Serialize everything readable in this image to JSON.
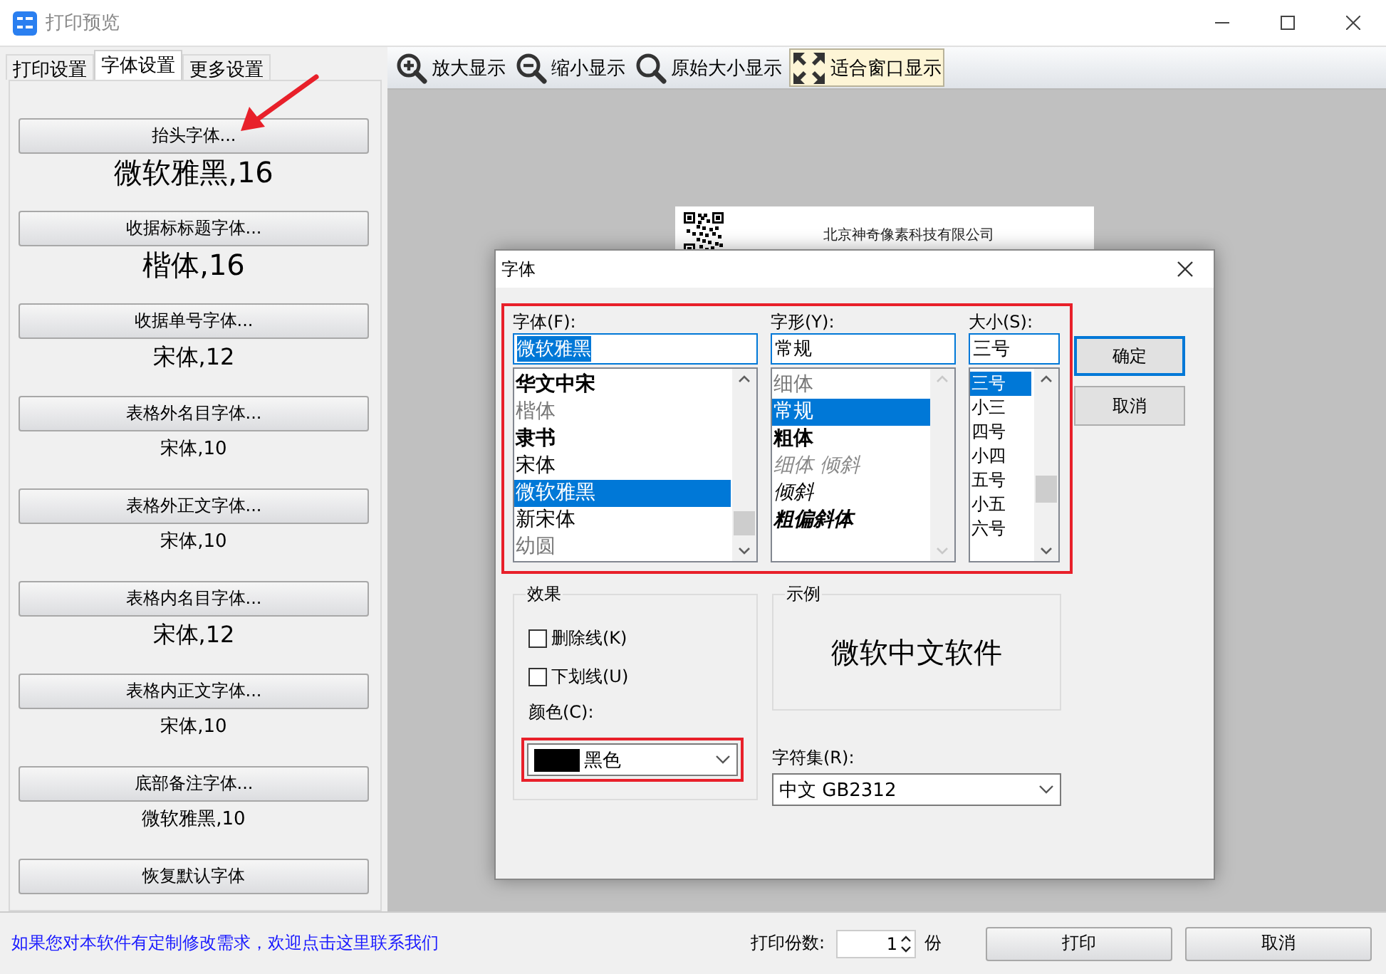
{
  "window": {
    "title": "打印预览"
  },
  "side_tabs": [
    {
      "label": "打印设置",
      "selected": false
    },
    {
      "label": "字体设置",
      "selected": true
    },
    {
      "label": "更多设置",
      "selected": false
    }
  ],
  "font_settings": [
    {
      "button": "抬头字体...",
      "sample": "微软雅黑,16",
      "kind": "large"
    },
    {
      "button": "收据标标题字体...",
      "sample": "楷体,16",
      "kind": "large"
    },
    {
      "button": "收据单号字体...",
      "sample": "宋体,12",
      "kind": "medium"
    },
    {
      "button": "表格外名目字体...",
      "sample": "宋体,10",
      "kind": "small"
    },
    {
      "button": "表格外正文字体...",
      "sample": "宋体,10",
      "kind": "small"
    },
    {
      "button": "表格内名目字体...",
      "sample": "宋体,12",
      "kind": "medium"
    },
    {
      "button": "表格内正文字体...",
      "sample": "宋体,10",
      "kind": "small"
    },
    {
      "button": "底部备注字体...",
      "sample": "微软雅黑,10",
      "kind": "small"
    }
  ],
  "reset_button": "恢复默认字体",
  "toolbar": [
    {
      "kind": "zoom-in",
      "label": "放大显示",
      "selected": false
    },
    {
      "kind": "zoom-out",
      "label": "缩小显示",
      "selected": false
    },
    {
      "kind": "actual-size",
      "label": "原始大小显示",
      "selected": false
    },
    {
      "kind": "fit",
      "label": "适合窗口显示",
      "selected": true
    }
  ],
  "preview": {
    "company": "北京神奇像素科技有限公司"
  },
  "font_dialog": {
    "title": "字体",
    "font": {
      "label": "字体(F):",
      "value": "微软雅黑",
      "items": [
        {
          "label": "华文中宋",
          "kind": "bold",
          "selected": false
        },
        {
          "label": "楷体",
          "kind": "light",
          "selected": false
        },
        {
          "label": "隶书",
          "kind": "bold",
          "selected": false
        },
        {
          "label": "宋体",
          "kind": "regular",
          "selected": false
        },
        {
          "label": "微软雅黑",
          "kind": "regular",
          "selected": true
        },
        {
          "label": "新宋体",
          "kind": "regular",
          "selected": false
        },
        {
          "label": "幼圆",
          "kind": "light",
          "selected": false
        }
      ]
    },
    "style": {
      "label": "字形(Y):",
      "value": "常规",
      "items": [
        {
          "label": "细体",
          "kind": "light",
          "selected": false
        },
        {
          "label": "常规",
          "kind": "regular",
          "selected": true
        },
        {
          "label": "粗体",
          "kind": "bold",
          "selected": false
        },
        {
          "label": "细体 倾斜",
          "kind": "light-italic",
          "selected": false
        },
        {
          "label": "倾斜",
          "kind": "italic",
          "selected": false
        },
        {
          "label": "粗偏斜体",
          "kind": "bold-italic",
          "selected": false
        }
      ]
    },
    "size": {
      "label": "大小(S):",
      "value": "三号",
      "items": [
        {
          "label": "三号",
          "selected": true
        },
        {
          "label": "小三",
          "selected": false
        },
        {
          "label": "四号",
          "selected": false
        },
        {
          "label": "小四",
          "selected": false
        },
        {
          "label": "五号",
          "selected": false
        },
        {
          "label": "小五",
          "selected": false
        },
        {
          "label": "六号",
          "selected": false
        }
      ]
    },
    "ok": "确定",
    "cancel": "取消",
    "effects": {
      "title": "效果",
      "options": [
        {
          "label": "删除线(K)",
          "checked": false
        },
        {
          "label": "下划线(U)",
          "checked": false
        }
      ],
      "color_label": "颜色(C):",
      "color": {
        "label": "黑色",
        "color": "#000000"
      }
    },
    "sample": {
      "title": "示例",
      "text": "微软中文软件"
    },
    "charset": {
      "label": "字符集(R):",
      "value": "中文 GB2312"
    }
  },
  "footer": {
    "link": "如果您对本软件有定制修改需求，欢迎点击这里联系我们",
    "copies_label": "打印份数:",
    "copies": "1",
    "unit": "份",
    "print": "打印",
    "cancel": "取消"
  }
}
